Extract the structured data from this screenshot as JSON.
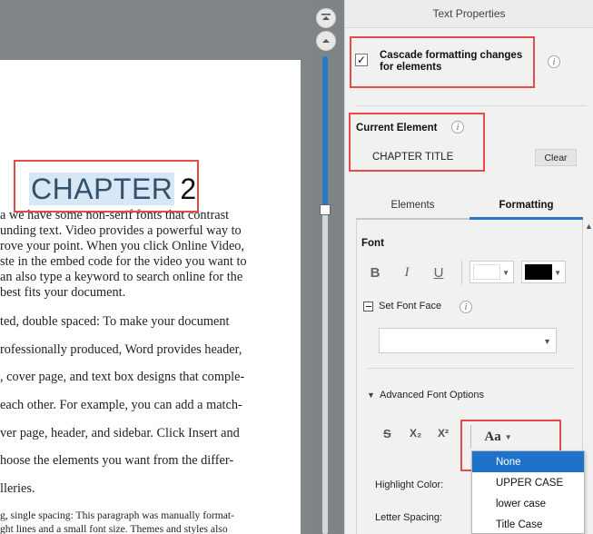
{
  "document": {
    "chapter_word": "CHAPTER",
    "chapter_number": "2",
    "lines": [
      "a we have some non-serif fonts that contrast",
      "unding text. Video provides a powerful way to",
      "rove your point. When you click Online Video,",
      "ste in the embed code for the video you want to",
      "an also type a keyword to search online for the",
      "best fits your document.",
      "ted, double spaced: To make your document",
      "rofessionally produced, Word provides header,",
      ", cover page, and text box designs that comple-",
      "each other. For example, you can add a match-",
      "ver page, header, and sidebar. Click Insert and",
      "hoose the elements you want from the differ-",
      "lleries.",
      "g, single spacing: This paragraph was manually format-",
      "ght lines and a small font size. Themes and styles also"
    ]
  },
  "panel": {
    "title": "Text Properties",
    "cascade_label": "Cascade formatting changes for elements",
    "cascade_checked": "✓",
    "current_element_label": "Current Element",
    "current_element_value": "CHAPTER TITLE",
    "clear_label": "Clear",
    "info_glyph": "i",
    "tabs": [
      {
        "label": "Elements"
      },
      {
        "label": "Formatting"
      }
    ],
    "font_label": "Font",
    "bold_glyph": "B",
    "italic_glyph": "I",
    "underline_glyph": "U",
    "set_font_face_label": "Set Font Face",
    "advanced_label": "Advanced Font Options",
    "strike_glyph": "S",
    "subscript_glyph": "X₂",
    "superscript_glyph": "X²",
    "case_glyph": "Aa",
    "highlight_label": "Highlight Color:",
    "letter_spacing_label": "Letter Spacing:",
    "case_options": [
      "None",
      "UPPER CASE",
      "lower case",
      "Title Case"
    ],
    "colors": {
      "accent": "#2a78c8",
      "highlight_swatch": "#ffffff",
      "text_swatch": "#000000",
      "annotation": "#e84a4a"
    }
  }
}
